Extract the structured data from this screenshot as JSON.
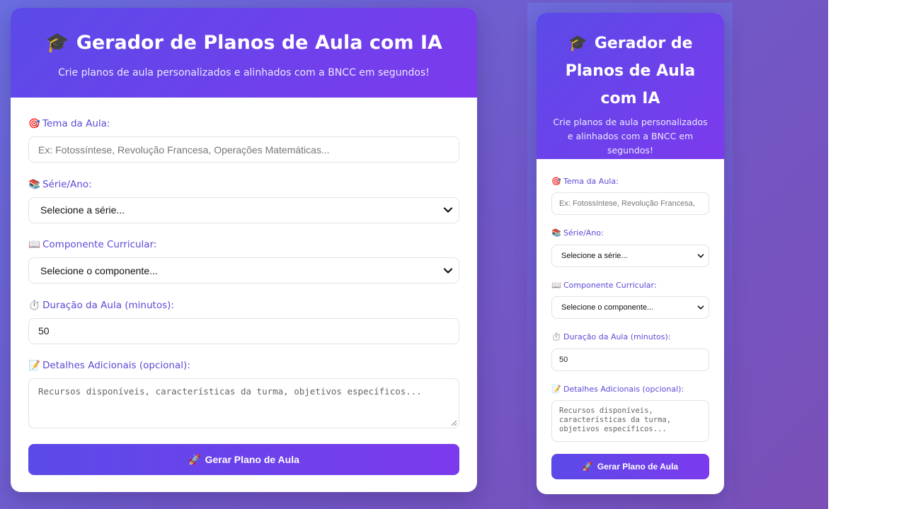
{
  "app": {
    "title_icon": "🎓",
    "title": "Gerador de Planos de Aula com IA",
    "subtitle": "Crie planos de aula personalizados e alinhados com a BNCC em segundos!"
  },
  "form": {
    "tema": {
      "icon": "🎯",
      "label": "Tema da Aula:",
      "placeholder": "Ex: Fotossíntese, Revolução Francesa, Operações Matemáticas...",
      "placeholder_mobile": "Ex: Fotossíntese, Revolução Francesa,"
    },
    "serie": {
      "icon": "📚",
      "label": "Série/Ano:",
      "selected": "Selecione a série..."
    },
    "componente": {
      "icon": "📖",
      "label": "Componente Curricular:",
      "selected": "Selecione o componente..."
    },
    "duracao": {
      "icon": "⏱️",
      "label": "Duração da Aula (minutos):",
      "value": "50"
    },
    "detalhes": {
      "icon": "📝",
      "label": "Detalhes Adicionais (opcional):",
      "placeholder": "Recursos disponíveis, características da turma, objetivos específicos..."
    },
    "submit": {
      "icon": "🚀",
      "label": "Gerar Plano de Aula"
    }
  },
  "colors": {
    "accent_start": "#5b4ae8",
    "accent_end": "#7c3aed",
    "label": "#5a4ad6"
  }
}
